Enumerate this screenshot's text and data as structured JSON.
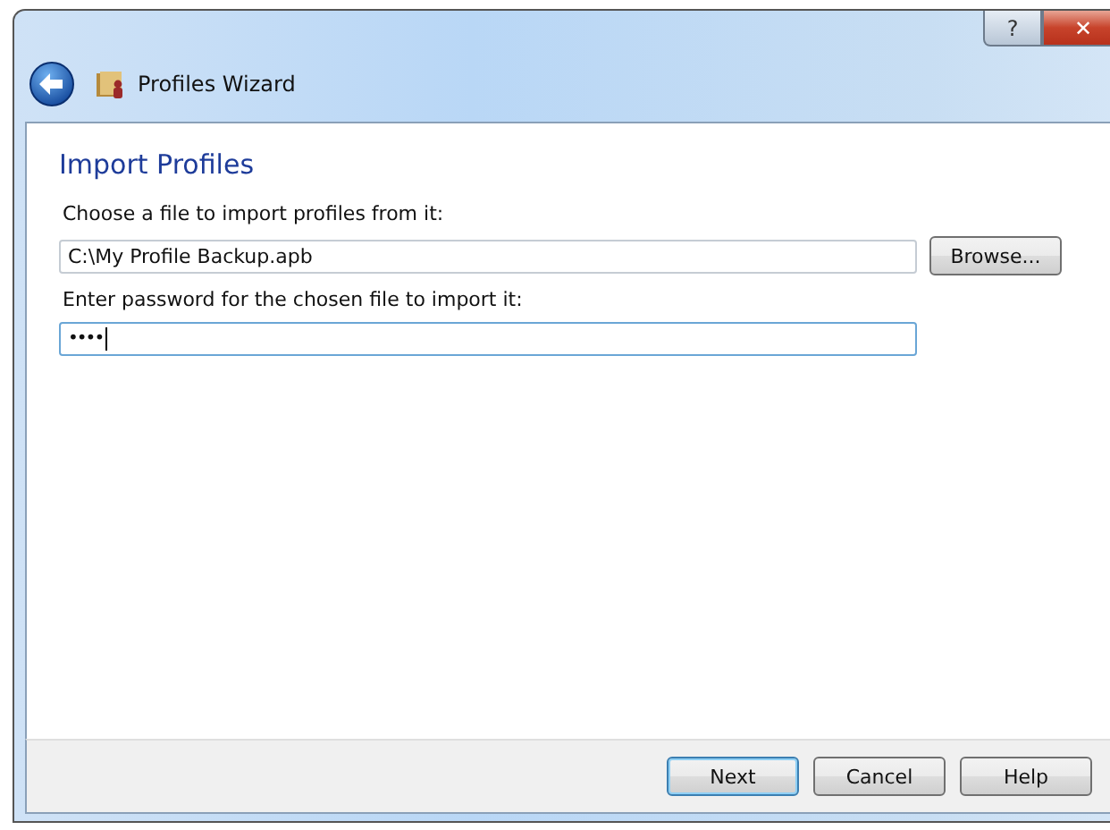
{
  "window": {
    "title": "Profiles Wizard",
    "caption_buttons": [
      {
        "kind": "help",
        "label": "?"
      },
      {
        "kind": "close",
        "label": "✕"
      }
    ]
  },
  "page": {
    "heading": "Import Profiles",
    "fields": [
      {
        "kind": "file",
        "label": "Choose a file to import profiles from it:",
        "value": "C:\\My Profile Backup.apb",
        "focused": false,
        "button": "Browse..."
      },
      {
        "kind": "password",
        "label": "Enter password for the chosen file to import it:",
        "value": "••••",
        "focused": true
      }
    ]
  },
  "buttons": [
    {
      "label": "Next",
      "default": true
    },
    {
      "label": "Cancel",
      "default": false
    },
    {
      "label": "Help",
      "default": false
    }
  ]
}
